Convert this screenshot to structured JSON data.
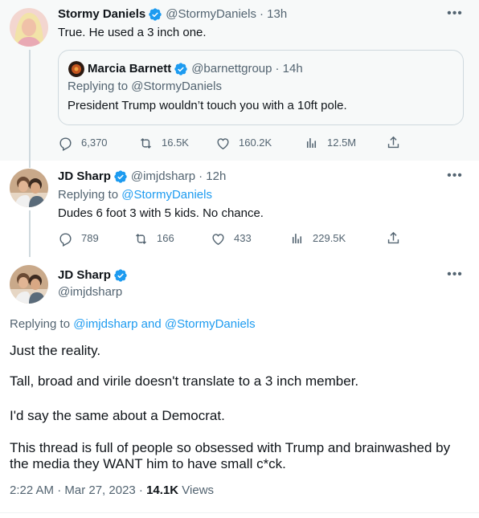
{
  "tweet1": {
    "author_name": "Stormy Daniels",
    "author_handle": "@StormyDaniels",
    "time": "· 13h",
    "text": "True. He used a 3 inch one.",
    "quote": {
      "author_name": "Marcia Barnett",
      "author_handle": "@barnettgroup",
      "time": "· 14h",
      "replying_prefix": "Replying to",
      "replying_handle": "@StormyDaniels",
      "text": "President Trump wouldn’t touch you with a 10ft pole."
    },
    "stats": {
      "replies": "6,370",
      "retweets": "16.5K",
      "likes": "160.2K",
      "views": "12.5M"
    }
  },
  "tweet2": {
    "author_name": "JD Sharp",
    "author_handle": "@imjdsharp",
    "time": "· 12h",
    "replying_prefix": "Replying to",
    "replying_handle": "@StormyDaniels",
    "text": "Dudes 6 foot 3 with 5 kids.  No chance.",
    "stats": {
      "replies": "789",
      "retweets": "166",
      "likes": "433",
      "views": "229.5K"
    }
  },
  "tweet3": {
    "author_name": "JD Sharp",
    "author_handle": "@imjdsharp",
    "replying_prefix": "Replying to",
    "replying_handle1": "@imjdsharp",
    "replying_and": "and",
    "replying_handle2": "@StormyDaniels",
    "paragraphs": [
      "Just the reality.",
      "Tall, broad and virile doesn't translate to a 3 inch member.",
      "I'd say the same about a Democrat.",
      "This thread is full of people so obsessed with Trump and brainwashed by",
      "the media they WANT him to have small c*ck."
    ],
    "timestamp": "2:22 AM · Mar 27, 2023 ·",
    "views_count": "14.1K",
    "views_label": "Views"
  },
  "colors": {
    "accent": "#1d9bf0",
    "muted": "#536471",
    "text": "#0f1419",
    "highlight_bg": "#f7f9f9"
  },
  "icons": [
    "more-icon",
    "verified-icon",
    "reply-icon",
    "retweet-icon",
    "like-icon",
    "views-icon",
    "share-icon"
  ]
}
